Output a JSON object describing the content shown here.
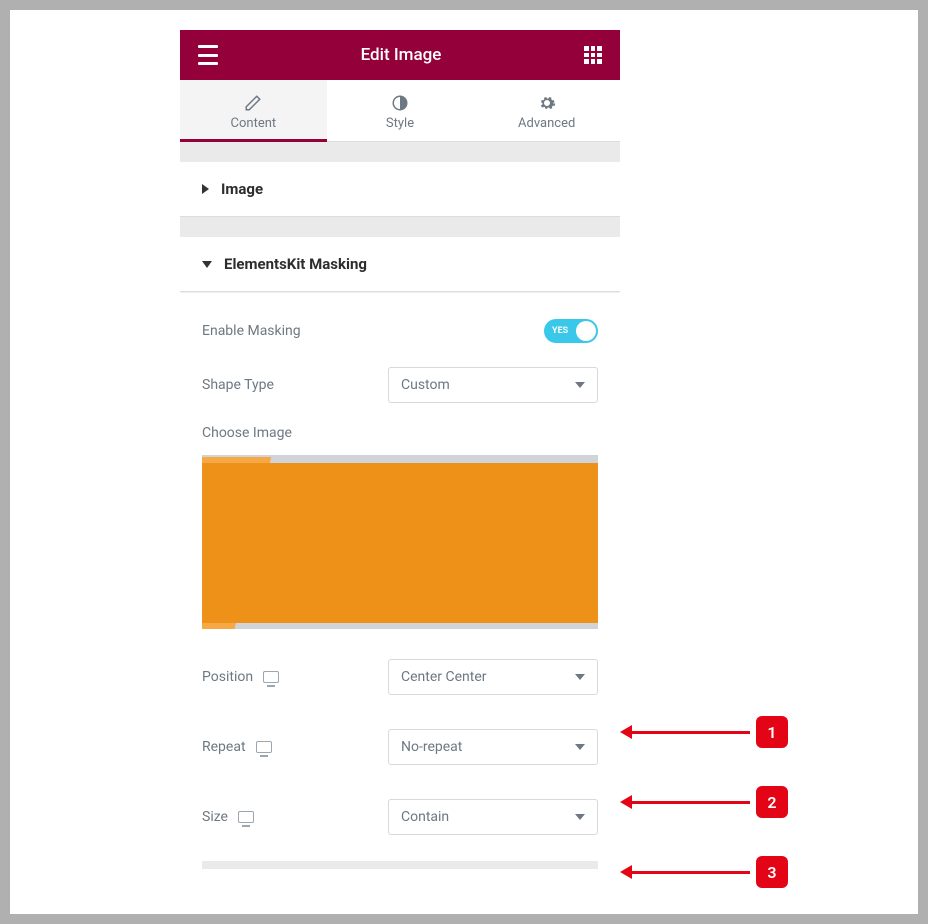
{
  "header": {
    "title": "Edit Image"
  },
  "tabs": {
    "content": "Content",
    "style": "Style",
    "advanced": "Advanced"
  },
  "sections": {
    "image": "Image",
    "masking": "ElementsKit Masking"
  },
  "controls": {
    "enable_masking_label": "Enable Masking",
    "enable_masking_state": "YES",
    "shape_type_label": "Shape Type",
    "shape_type_value": "Custom",
    "choose_image_label": "Choose Image",
    "position_label": "Position",
    "position_value": "Center Center",
    "repeat_label": "Repeat",
    "repeat_value": "No-repeat",
    "size_label": "Size",
    "size_value": "Contain"
  },
  "annotations": {
    "a1": "1",
    "a2": "2",
    "a3": "3"
  }
}
